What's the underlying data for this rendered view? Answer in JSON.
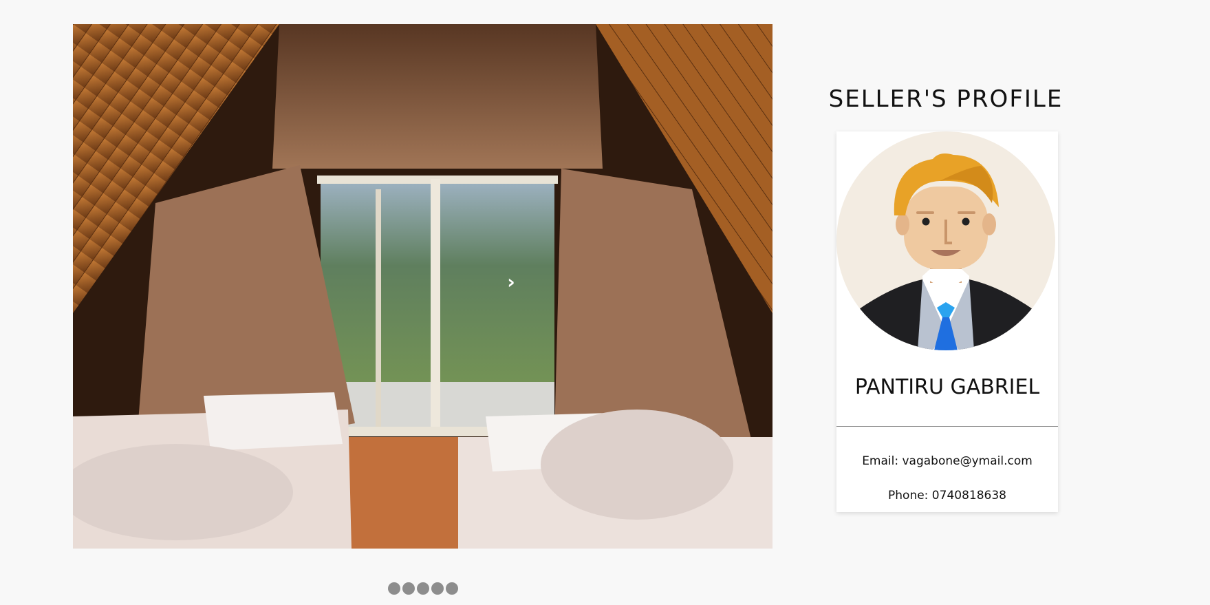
{
  "slideshow": {
    "image_description": "attic bedroom with wooden A-frame ceiling, curtains and window overlooking mountains",
    "next_icon": "›",
    "dot_count": 5
  },
  "profile": {
    "title": "SELLER'S PROFILE",
    "name": "PANTIRU GABRIEL",
    "email_line": "Email: vagabone@ymail.com",
    "phone_line": "Phone: 0740818638"
  },
  "colors": {
    "page_background": "#f8f8f8",
    "card_background": "#ffffff",
    "dot": "#8d8d8d",
    "avatar_bg": "#f3ece2",
    "hair": "#e8a227",
    "tie": "#1f7ee8"
  }
}
